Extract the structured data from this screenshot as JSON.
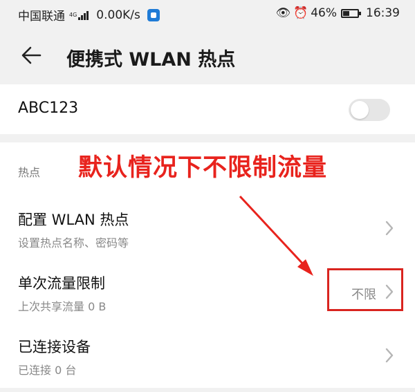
{
  "status_bar": {
    "carrier": "中国联通",
    "network_tag": "4G",
    "speed": "0.00K/s",
    "battery": "46%",
    "battery_fraction": 0.46,
    "time": "16:39"
  },
  "header": {
    "title": "便携式 WLAN 热点"
  },
  "ssid_card": {
    "label": "ABC123",
    "toggle_on": false
  },
  "section": {
    "label": "热点"
  },
  "rows": [
    {
      "title": "配置 WLAN 热点",
      "subtitle": "设置热点名称、密码等",
      "value": ""
    },
    {
      "title": "单次流量限制",
      "subtitle": "上次共享流量 0 B",
      "value": "不限"
    },
    {
      "title": "已连接设备",
      "subtitle": "已连接 0 台",
      "value": ""
    }
  ],
  "annotation": {
    "text": "默认情况下不限制流量",
    "color": "#e8231d"
  }
}
